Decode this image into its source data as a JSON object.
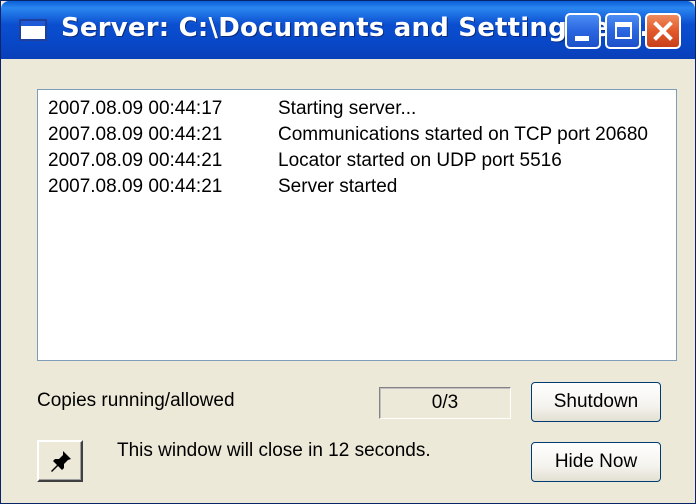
{
  "window": {
    "title": "Server: C:\\Documents and Settings\\ej...",
    "app_icon": "window-icon",
    "controls": {
      "minimize_icon": "minimize-icon",
      "maximize_icon": "maximize-icon",
      "close_icon": "close-icon"
    }
  },
  "log": {
    "entries": [
      {
        "time": "2007.08.09 00:44:17",
        "message": "Starting server..."
      },
      {
        "time": "2007.08.09 00:44:21",
        "message": "Communications started on TCP port 20680"
      },
      {
        "time": "2007.08.09 00:44:21",
        "message": "Locator started on UDP port 5516"
      },
      {
        "time": "2007.08.09 00:44:21",
        "message": "Server started"
      }
    ]
  },
  "copies": {
    "label": "Copies running/allowed",
    "value": "0/3"
  },
  "buttons": {
    "shutdown": "Shutdown",
    "hide_now": "Hide Now",
    "pin_icon": "pushpin-icon"
  },
  "countdown_text": "This window will close in 12 seconds.",
  "colors": {
    "titlebar": "#0a4fd0",
    "window_bg": "#ece9d8",
    "close_button": "#e25a2a"
  }
}
